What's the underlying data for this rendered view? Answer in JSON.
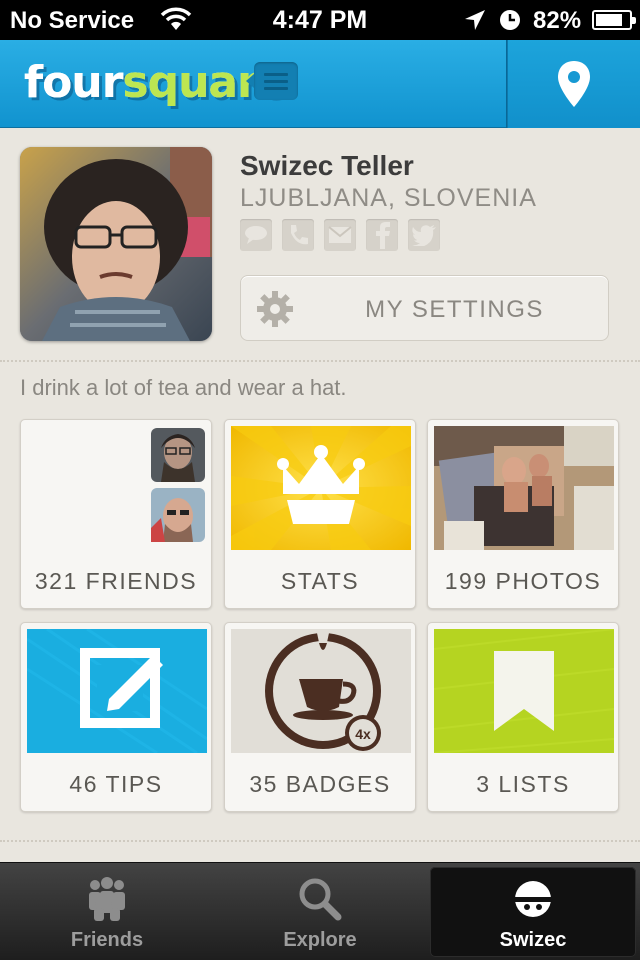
{
  "status_bar": {
    "carrier": "No Service",
    "time": "4:47 PM",
    "battery_percent": "82%",
    "battery_level": 0.82,
    "icons": [
      "wifi-icon",
      "location-arrow-icon",
      "clock-icon",
      "battery-icon"
    ]
  },
  "nav": {
    "logo_part1": "four",
    "logo_part2": "square",
    "menu_icon": "menu-icon",
    "right_icon": "map-pin-icon",
    "colors": {
      "bar": "#1ba3dc",
      "logo_accent": "#bde651"
    }
  },
  "profile": {
    "name": "Swizec Teller",
    "location": "LJUBLJANA, SLOVENIA",
    "contact_icons": [
      "message-icon",
      "phone-icon",
      "email-icon",
      "facebook-icon",
      "twitter-icon"
    ],
    "settings_label": "MY SETTINGS",
    "bio": "I drink a lot of tea and wear a hat."
  },
  "tiles": [
    {
      "label": "321 FRIENDS",
      "icon": "friends-avatars"
    },
    {
      "label": "STATS",
      "icon": "crown-icon",
      "color": "#f5c400"
    },
    {
      "label": "199 PHOTOS",
      "icon": "photo-thumbnail"
    },
    {
      "label": "46 TIPS",
      "icon": "edit-icon",
      "color": "#1aaee0"
    },
    {
      "label": "35 BADGES",
      "icon": "tea-cup-badge-icon",
      "badge_count": "4x"
    },
    {
      "label": "3 LISTS",
      "icon": "bookmark-icon",
      "color": "#b5d421"
    }
  ],
  "tab_bar": {
    "tabs": [
      {
        "label": "Friends",
        "icon": "friends-icon",
        "active": false
      },
      {
        "label": "Explore",
        "icon": "search-icon",
        "active": false
      },
      {
        "label": "Swizec",
        "icon": "profile-icon",
        "active": true
      }
    ]
  }
}
